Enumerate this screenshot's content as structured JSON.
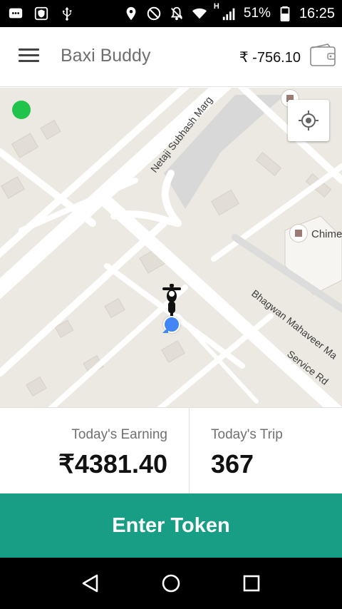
{
  "status_bar": {
    "battery": "51%",
    "time": "16:25",
    "network": "H",
    "icons": [
      "message-icon",
      "shield-icon",
      "usb-icon",
      "location-icon",
      "blocked-icon",
      "notifications-off-icon",
      "wifi-icon",
      "signal-icon",
      "battery-icon"
    ]
  },
  "app_bar": {
    "title": "Baxi Buddy",
    "balance": "₹ -756.10"
  },
  "map": {
    "labels": {
      "road1": "Netaji Subhash Marg",
      "road2": "Bhagwan Mahaveer Ma",
      "road3": "Service Rd",
      "place1": "Chime"
    },
    "colors": {
      "online": "#20c44a",
      "location": "#4285f4"
    }
  },
  "stats": {
    "earning_label": "Today's Earning",
    "earning_value": "₹4381.40",
    "trip_label": "Today's Trip",
    "trip_value": "367"
  },
  "token_button": {
    "label": "Enter Token",
    "color": "#179e84"
  }
}
